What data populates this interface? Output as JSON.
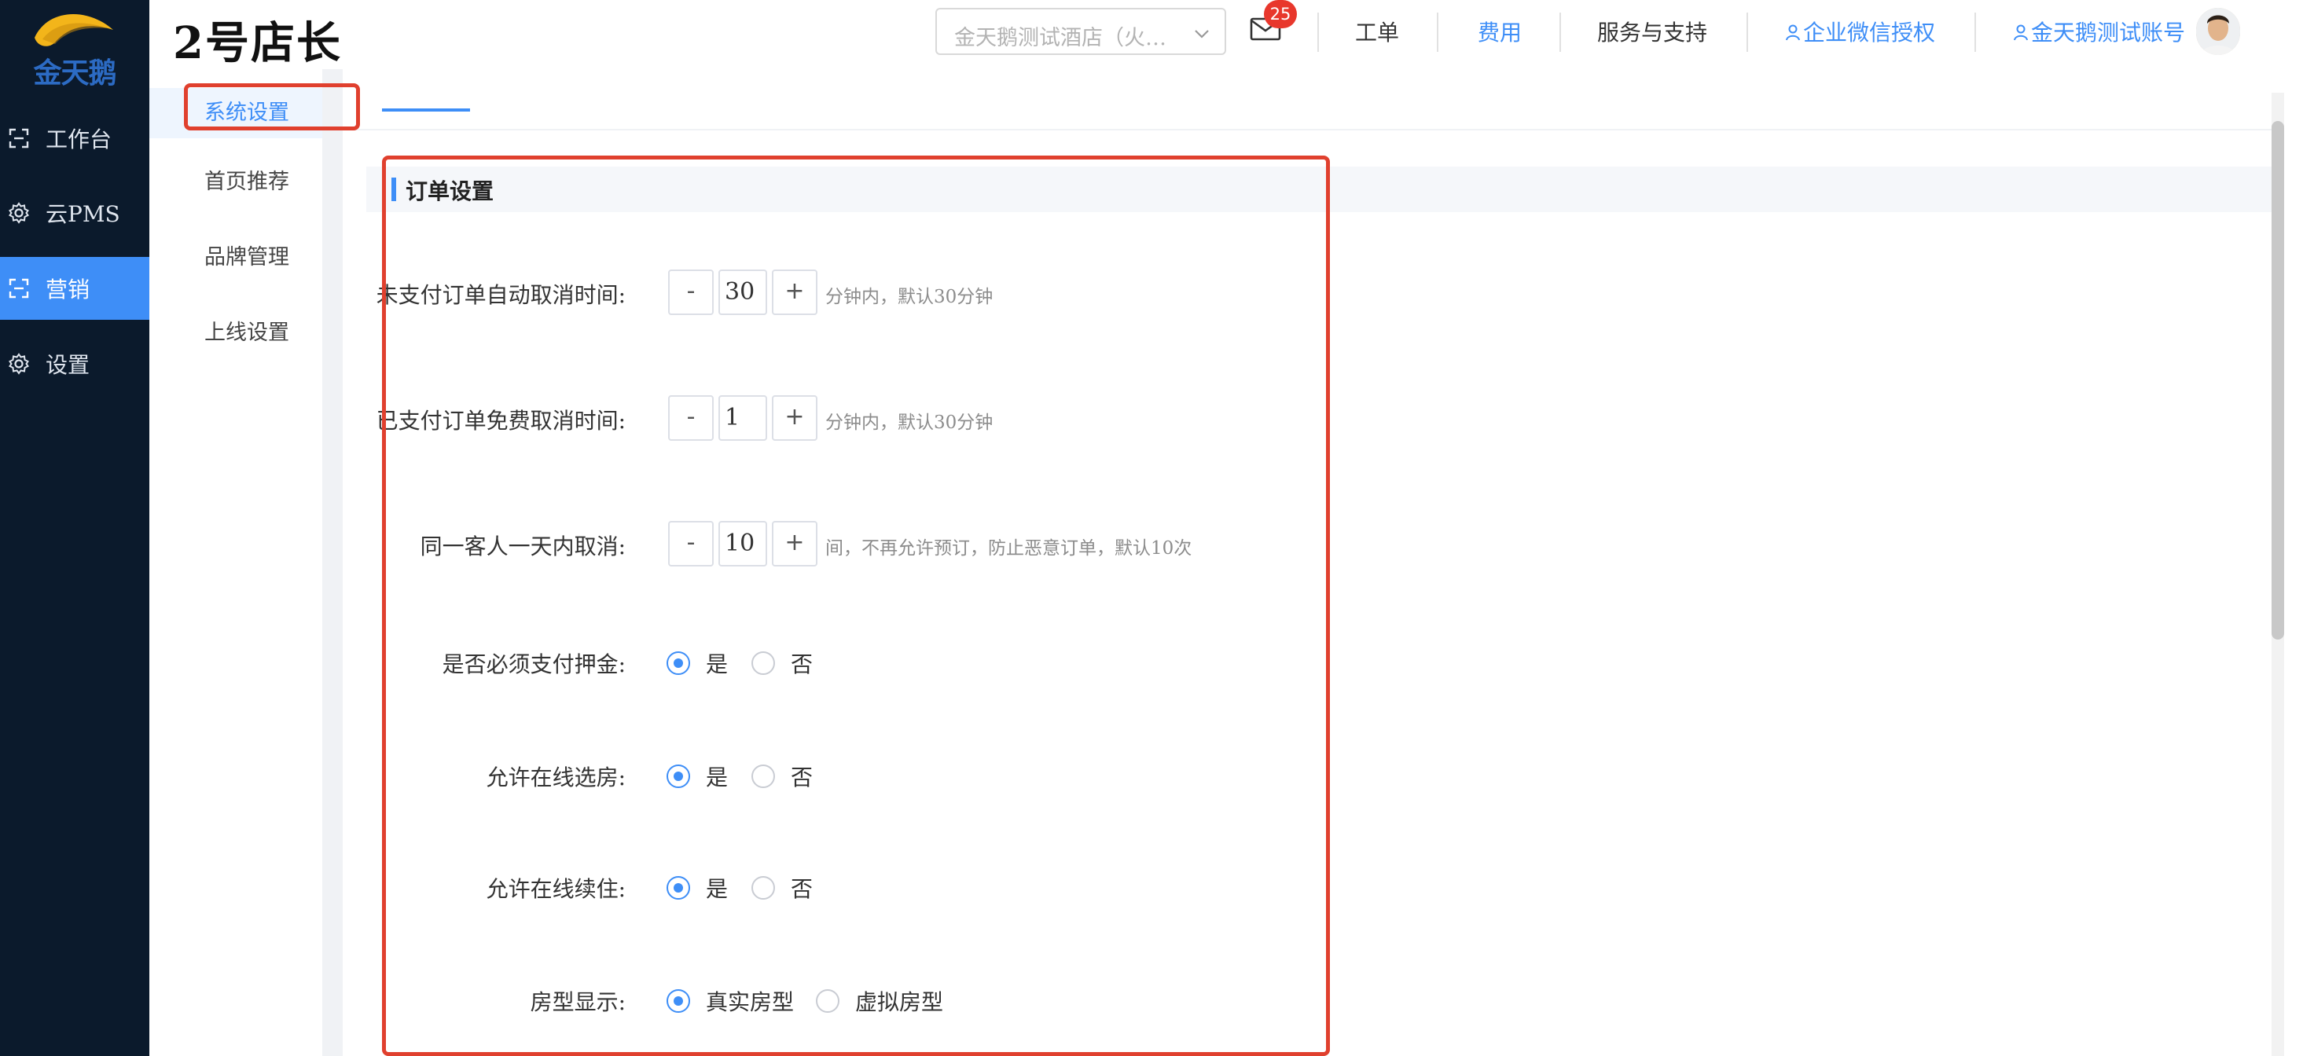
{
  "brand": {
    "logo_text": "金天鹅",
    "app_title": "2号店长"
  },
  "nav": {
    "items": [
      {
        "label": "工作台",
        "icon": "workbench-icon"
      },
      {
        "label": "云PMS",
        "icon": "gear-icon"
      },
      {
        "label": "营销",
        "icon": "marketing-icon"
      },
      {
        "label": "设置",
        "icon": "gear-icon"
      }
    ],
    "active_index": 2
  },
  "header": {
    "store_select": {
      "value": "金天鹅测试酒店（火…",
      "icon": "chevron-down-icon"
    },
    "mail": {
      "icon": "mail-icon",
      "badge": "25"
    },
    "links": {
      "work_order": "工单",
      "fees": "费用",
      "service": "服务与支持",
      "wecom_auth": "企业微信授权",
      "account": "金天鹅测试账号"
    }
  },
  "submenu": {
    "items": [
      "系统设置",
      "首页推荐",
      "品牌管理",
      "上线设置"
    ],
    "active_index": 0
  },
  "content": {
    "section_title": "订单设置",
    "steppers": [
      {
        "label": "未支付订单自动取消时间:",
        "value": "30",
        "minus": "-",
        "plus": "+",
        "hint": "分钟内，默认30分钟"
      },
      {
        "label": "已支付订单免费取消时间:",
        "value": "1",
        "minus": "-",
        "plus": "+",
        "hint": "分钟内，默认30分钟"
      },
      {
        "label": "同一客人一天内取消:",
        "value": "10",
        "minus": "-",
        "plus": "+",
        "hint": "间，不再允许预订，防止恶意订单，默认10次"
      }
    ],
    "radios": [
      {
        "label": "是否必须支付押金:",
        "options": [
          "是",
          "否"
        ],
        "selected": 0
      },
      {
        "label": "允许在线选房:",
        "options": [
          "是",
          "否"
        ],
        "selected": 0
      },
      {
        "label": "允许在线续住:",
        "options": [
          "是",
          "否"
        ],
        "selected": 0
      },
      {
        "label": "房型显示:",
        "options": [
          "真实房型",
          "虚拟房型"
        ],
        "selected": 0
      }
    ]
  },
  "colors": {
    "accent": "#3e8ef7",
    "nav_bg": "#0b1a2c",
    "annotation": "#e0402e",
    "badge": "#e8372c"
  }
}
